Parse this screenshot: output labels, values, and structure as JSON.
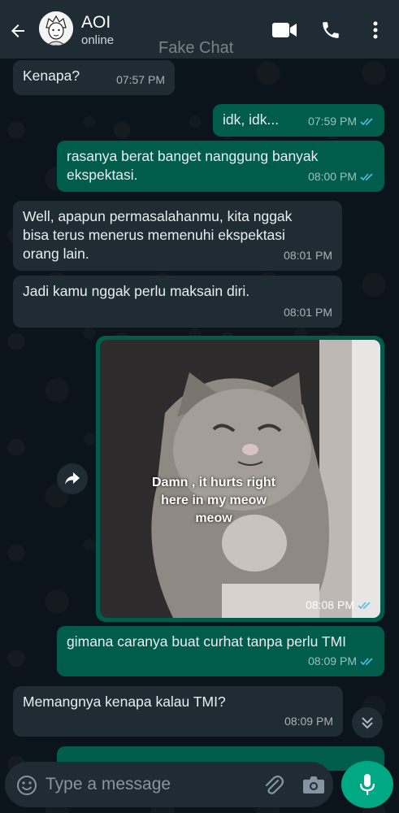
{
  "header": {
    "contact_name": "AOI",
    "status": "online",
    "watermark": "Fake Chat"
  },
  "messages": [
    {
      "direction": "in",
      "text": "Kenapa?",
      "time": "07:57 PM"
    },
    {
      "direction": "out",
      "text": "idk, idk...",
      "time": "07:59 PM",
      "read": true
    },
    {
      "direction": "out",
      "text": "rasanya berat banget nanggung banyak ekspektasi.",
      "time": "08:00 PM",
      "read": true
    },
    {
      "direction": "in",
      "text": "Well, apapun permasalahanmu, kita nggak bisa terus menerus memenuhi ekspektasi orang lain.",
      "time": "08:01 PM"
    },
    {
      "direction": "in",
      "text": "Jadi kamu nggak perlu maksain diri.",
      "time": "08:01 PM"
    },
    {
      "direction": "out",
      "type": "image",
      "caption_lines": [
        "Damn , it hurts right",
        "here in my meow",
        "meow"
      ],
      "time": "08:08 PM",
      "read": true
    },
    {
      "direction": "out",
      "text": "gimana caranya buat curhat tanpa perlu TMI",
      "time": "08:09 PM",
      "read": true
    },
    {
      "direction": "in",
      "text": "Memangnya kenapa kalau TMI?",
      "time": "08:09 PM"
    }
  ],
  "composer": {
    "placeholder": "Type a message"
  },
  "colors": {
    "incoming_bubble": "#202c33",
    "outgoing_bubble": "#005c4b",
    "accent": "#00a884",
    "read_ticks": "#53bdeb"
  },
  "icons": {
    "back": "arrow-left-icon",
    "video": "video-camera-icon",
    "call": "phone-icon",
    "menu": "more-vert-icon",
    "forward": "forward-arrow-icon",
    "scroll_down": "chevron-double-down-icon",
    "emoji": "emoji-icon",
    "attach": "paperclip-icon",
    "camera": "camera-icon",
    "mic": "microphone-icon"
  }
}
